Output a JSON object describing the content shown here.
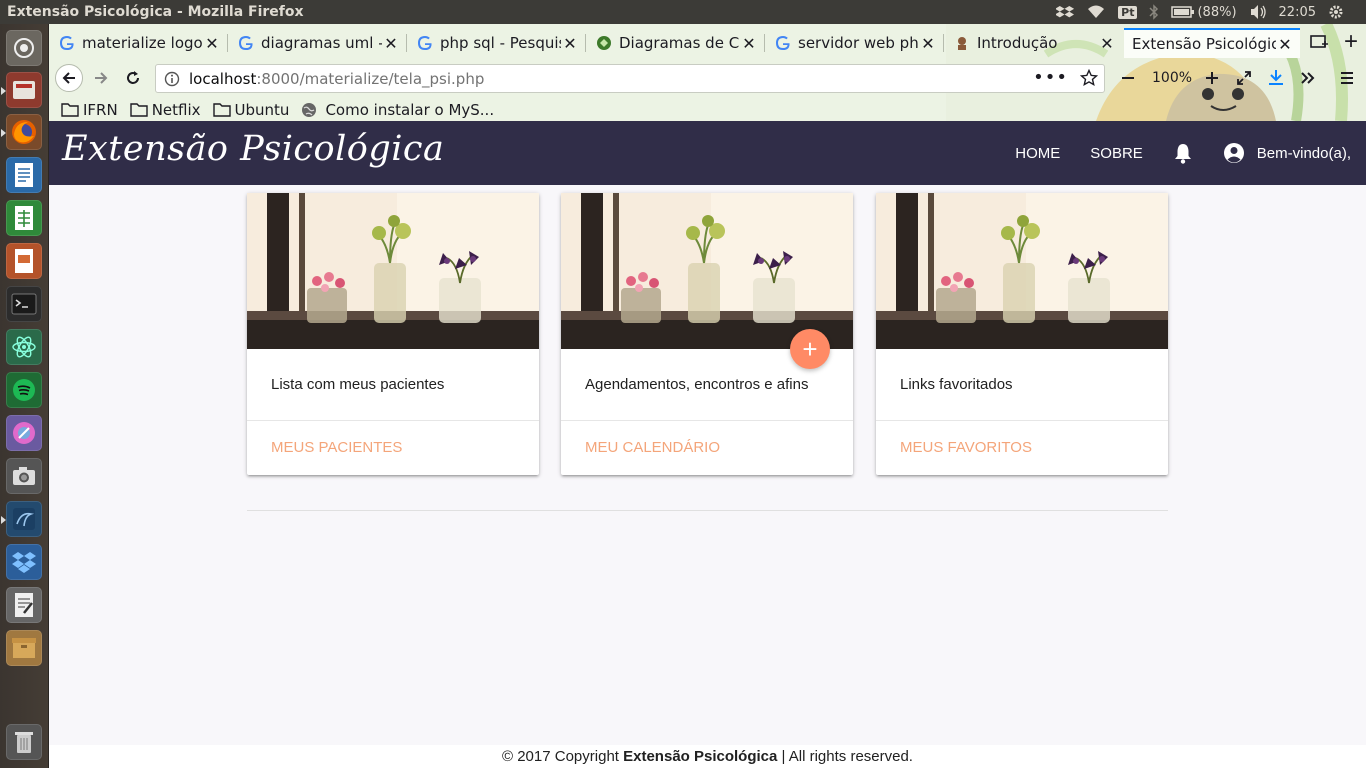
{
  "os": {
    "window_title": "Extensão Psicológica - Mozilla Firefox",
    "keyboard_layout": "Pt",
    "battery": "(88%)",
    "clock": "22:05"
  },
  "browser": {
    "tabs": [
      {
        "label": "materialize logo -",
        "icon": "google-icon"
      },
      {
        "label": "diagramas uml - P",
        "icon": "google-icon"
      },
      {
        "label": "php sql - Pesquisa",
        "icon": "google-icon"
      },
      {
        "label": "Diagramas de Cas",
        "icon": "web-icon"
      },
      {
        "label": "servidor web php",
        "icon": "google-icon"
      },
      {
        "label": "Introdução",
        "icon": "site-icon"
      },
      {
        "label": "Extensão Psicológica",
        "icon": "none",
        "active": true
      }
    ],
    "url_host": "localhost",
    "url_path": ":8000/materialize/tela_psi.php",
    "zoom": "100%",
    "bookmarks": [
      {
        "label": "IFRN",
        "icon": "folder-icon"
      },
      {
        "label": "Netflix",
        "icon": "folder-icon"
      },
      {
        "label": "Ubuntu",
        "icon": "folder-icon"
      },
      {
        "label": "Como instalar o MyS...",
        "icon": "globe-icon"
      }
    ]
  },
  "site": {
    "brand": "Extensão Psicológica",
    "nav": {
      "home": "HOME",
      "about": "SOBRE",
      "welcome": "Bem-vindo(a),"
    },
    "cards": [
      {
        "text": "Lista com meus pacientes",
        "action": "MEUS PACIENTES",
        "fab": false
      },
      {
        "text": "Agendamentos, encontros e afins",
        "action": "MEU CALENDÁRIO",
        "fab": true,
        "fab_label": "+"
      },
      {
        "text": "Links favoritados",
        "action": "MEUS FAVORITOS",
        "fab": false
      }
    ],
    "footer": {
      "prefix": "© 2017 Copyright ",
      "brand": "Extensão Psicológica",
      "suffix": " | All rights reserved."
    },
    "colors": {
      "navbar": "#302d48",
      "accent": "#ff8a65",
      "action_text": "#f4a57a",
      "background": "#f8f7fa"
    }
  }
}
